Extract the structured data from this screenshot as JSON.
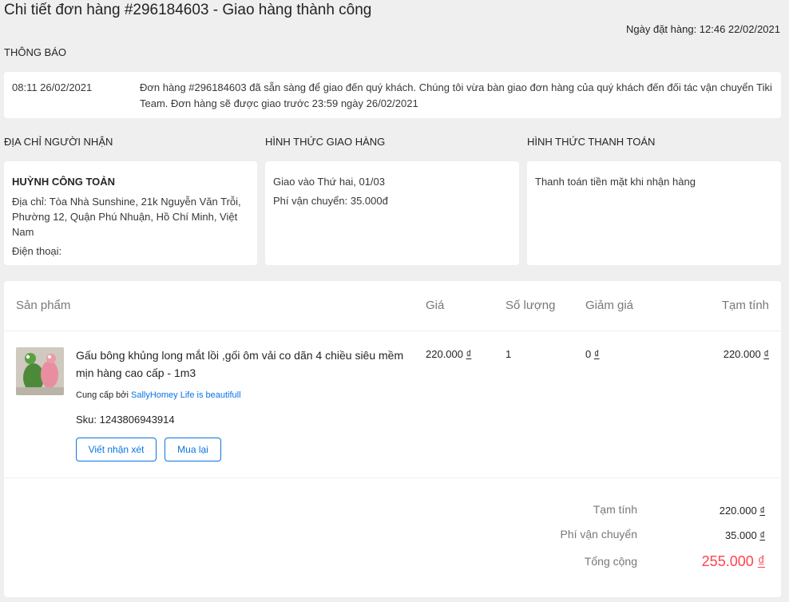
{
  "header": {
    "title_prefix": "Chi tiết đơn hàng #296184603 - ",
    "title_status": "Giao hàng thành công",
    "order_date": "Ngày đặt hàng: 12:46 22/02/2021"
  },
  "notice": {
    "heading": "THÔNG BÁO",
    "time": "08:11 26/02/2021",
    "message": "Đơn hàng #296184603 đã sẵn sàng để giao đến quý khách. Chúng tôi vừa bàn giao đơn hàng của quý khách đến đối tác vận chuyển Tiki Team. Đơn hàng sẽ được giao trước 23:59 ngày 26/02/2021"
  },
  "address": {
    "heading": "ĐỊA CHỈ NGƯỜI NHẬN",
    "name": "HUỲNH CÔNG TOẢN",
    "address": "Địa chỉ: Tòa Nhà Sunshine, 21k Nguyễn Văn Trỗi, Phường 12, Quận Phú Nhuận, Hồ Chí Minh, Việt Nam",
    "phone": "Điện thoại:"
  },
  "shipping": {
    "heading": "HÌNH THỨC GIAO HÀNG",
    "delivery": "Giao vào Thứ hai, 01/03",
    "fee": "Phí vận chuyển: 35.000đ"
  },
  "payment": {
    "heading": "HÌNH THỨC THANH TOÁN",
    "method": "Thanh toán tiền mặt khi nhận hàng"
  },
  "table": {
    "headers": {
      "product": "Sản phẩm",
      "price": "Giá",
      "quantity": "Số lượng",
      "discount": "Giảm giá",
      "subtotal": "Tạm tính"
    },
    "item": {
      "name": "Gấu bông khủng long mắt lồi ,gối ôm vải co dãn 4 chiều siêu mềm mịn hàng cao cấp - 1m3",
      "seller_prefix": "Cung cấp bởi ",
      "seller": "SallyHomey Life is beautifull",
      "sku": "Sku: 1243806943914",
      "price": "220.000 ",
      "quantity": "1",
      "discount": "0 ",
      "subtotal": "220.000 ",
      "review_label": "Viết nhận xét",
      "rebuy_label": "Mua lại"
    },
    "currency": "₫"
  },
  "summary": {
    "subtotal_label": "Tạm tính",
    "subtotal_value": "220.000 ",
    "shipping_label": "Phí vận chuyển",
    "shipping_value": "35.000 ",
    "total_label": "Tổng cộng",
    "total_value": "255.000 "
  },
  "colors": {
    "link": "#0b74e5",
    "total": "#ff424e"
  }
}
